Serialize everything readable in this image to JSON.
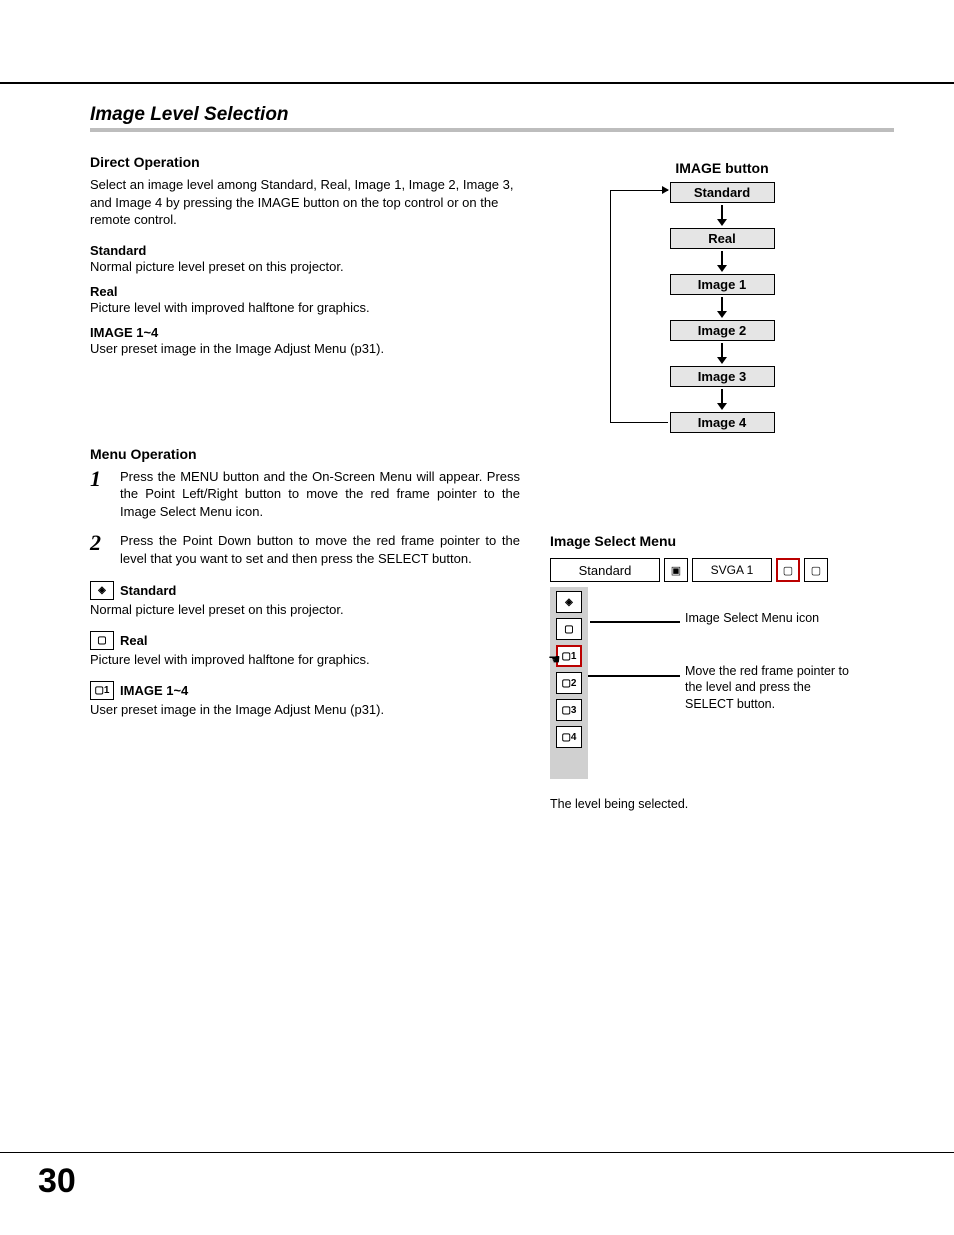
{
  "section_title": "Image Level Selection",
  "direct_operation": {
    "heading": "Direct Operation",
    "intro": "Select an image level among Standard, Real, Image 1, Image 2, Image 3, and Image 4 by pressing the IMAGE button on the top control or on the remote control.",
    "defs": [
      {
        "title": "Standard",
        "desc": "Normal picture level preset on this projector."
      },
      {
        "title": "Real",
        "desc": "Picture level with improved halftone for graphics."
      },
      {
        "title": "IMAGE 1~4",
        "desc": "User preset image in the Image Adjust Menu (p31)."
      }
    ]
  },
  "flow": {
    "title": "IMAGE button",
    "items": [
      "Standard",
      "Real",
      "Image 1",
      "Image 2",
      "Image 3",
      "Image 4"
    ]
  },
  "menu_operation": {
    "heading": "Menu Operation",
    "steps": [
      "Press the MENU button and the On-Screen Menu will appear. Press the Point Left/Right button to move the red frame pointer to the Image Select Menu icon.",
      "Press the Point Down button to move the red frame pointer to the level that you want to set and then press the SELECT button."
    ],
    "defs": [
      {
        "icon": "◈",
        "title": "Standard",
        "desc": "Normal picture level preset on this projector."
      },
      {
        "icon": "▢",
        "title": "Real",
        "desc": "Picture level with improved halftone for graphics."
      },
      {
        "icon": "▢1",
        "title": "IMAGE 1~4",
        "desc": "User preset image in the Image Adjust Menu (p31)."
      }
    ]
  },
  "ism": {
    "title": "Image Select Menu",
    "current": "Standard",
    "resolution": "SVGA 1",
    "note1": "Image Select Menu icon",
    "note2": "Move the red frame pointer to the level and press the SELECT button.",
    "slots": [
      "◈",
      "▢",
      "▢1",
      "▢2",
      "▢3",
      "▢4"
    ],
    "caption": "The level being selected."
  },
  "page_number": "30"
}
